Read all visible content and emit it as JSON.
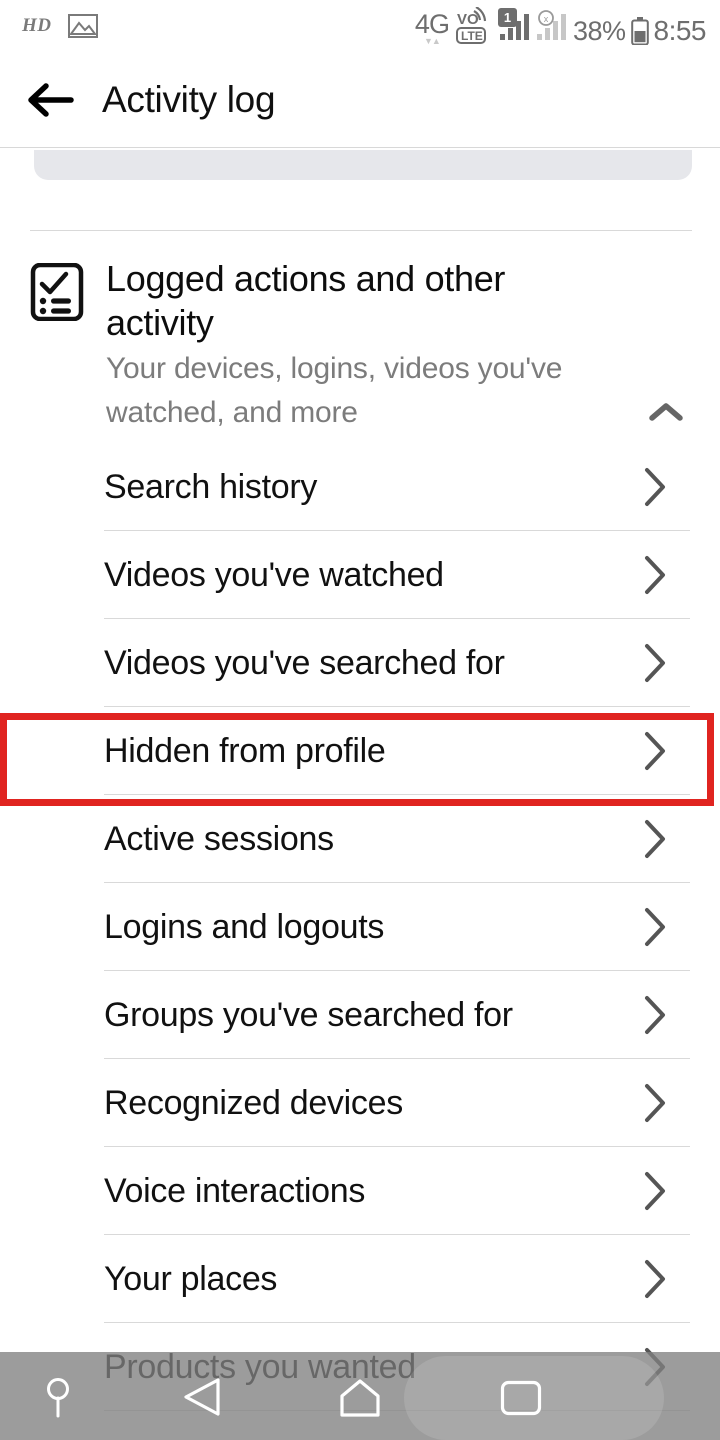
{
  "statusbar": {
    "hd_label": "HD",
    "picture_icon": "picture-icon",
    "network_label": "4G",
    "volte_label_top": "VO",
    "volte_label_bottom": "LTE",
    "sim_badge": "1",
    "battery_percent": "38%",
    "time": "8:55"
  },
  "header": {
    "back_icon": "back-arrow-icon",
    "title": "Activity log"
  },
  "section": {
    "icon": "checklist-clipboard-icon",
    "title": "Logged actions and other activity",
    "subtitle": "Your devices, logins, videos you've watched, and more",
    "collapse_icon": "chevron-up-icon",
    "expanded": true
  },
  "list": {
    "chevron_icon": "chevron-right-icon",
    "items": [
      {
        "label": "Search history"
      },
      {
        "label": "Videos you've watched"
      },
      {
        "label": "Videos you've searched for"
      },
      {
        "label": "Hidden from profile"
      },
      {
        "label": "Active sessions"
      },
      {
        "label": "Logins and logouts"
      },
      {
        "label": "Groups you've searched for"
      },
      {
        "label": "Recognized devices"
      },
      {
        "label": "Voice interactions"
      },
      {
        "label": "Your places"
      },
      {
        "label": "Products you wanted"
      }
    ]
  },
  "highlight": {
    "target_label": "Hidden from profile",
    "color": "#e02420"
  },
  "navbar": {
    "keep_icon": "navbar-keep-pin-icon",
    "back_icon": "navbar-back-icon",
    "home_icon": "navbar-home-icon",
    "recents_icon": "navbar-recents-icon"
  }
}
